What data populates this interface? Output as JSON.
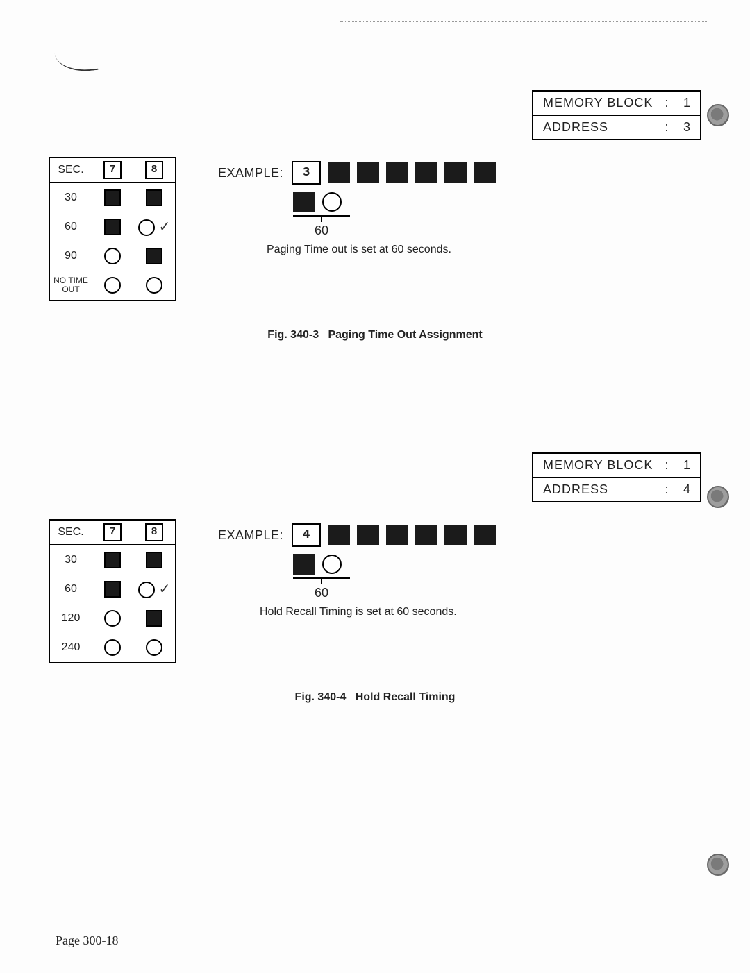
{
  "figure1": {
    "info": {
      "memory_label": "MEMORY BLOCK",
      "memory_value": "1",
      "address_label": "ADDRESS",
      "address_value": "3"
    },
    "sec_header": "SEC.",
    "col7": "7",
    "col8": "8",
    "rows": [
      {
        "label": "30",
        "b7": "filled",
        "b8": "filled"
      },
      {
        "label": "60",
        "b7": "filled",
        "b8": "open",
        "check": true
      },
      {
        "label": "90",
        "b7": "open",
        "b8": "filled"
      },
      {
        "label": "NO TIME OUT",
        "small": true,
        "b7": "open",
        "b8": "open"
      }
    ],
    "example_label": "EXAMPLE:",
    "example_digit": "3",
    "example_annot": "60",
    "example_note": "Paging Time out is set at 60 seconds.",
    "caption_id": "Fig. 340-3",
    "caption_text": "Paging Time Out Assignment"
  },
  "figure2": {
    "info": {
      "memory_label": "MEMORY BLOCK",
      "memory_value": "1",
      "address_label": "ADDRESS",
      "address_value": "4"
    },
    "sec_header": "SEC.",
    "col7": "7",
    "col8": "8",
    "rows": [
      {
        "label": "30",
        "b7": "filled",
        "b8": "filled"
      },
      {
        "label": "60",
        "b7": "filled",
        "b8": "open",
        "check": true
      },
      {
        "label": "120",
        "b7": "open",
        "b8": "filled"
      },
      {
        "label": "240",
        "b7": "open",
        "b8": "open"
      }
    ],
    "example_label": "EXAMPLE:",
    "example_digit": "4",
    "example_annot": "60",
    "example_note": "Hold Recall Timing is set at 60 seconds.",
    "caption_id": "Fig. 340-4",
    "caption_text": "Hold Recall Timing"
  },
  "page_number": "Page 300-18"
}
